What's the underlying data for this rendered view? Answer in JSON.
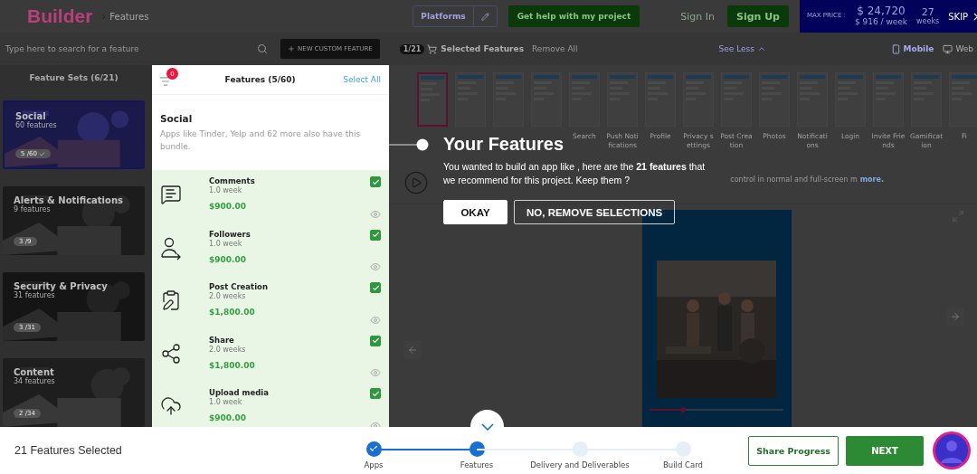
{
  "header": {
    "logo": "Builder",
    "breadcrumb": "Features",
    "platforms_button": "Platforms",
    "help_button": "Get help with my project",
    "sign_in": "Sign In",
    "sign_up": "Sign Up",
    "price": {
      "label": "MAX PRICE :",
      "total": "$ 24,720",
      "weekly": "$ 916 / week",
      "duration": "27",
      "duration_unit": "weeks"
    },
    "skip": "SKIP"
  },
  "toolbar": {
    "search_placeholder": "Type here to search for a feature",
    "new_feature_button": "NEW CUSTOM FEATURE",
    "selected_count": "1/21",
    "selected_label": "Selected Features",
    "remove_all": "Remove All",
    "see_less": "See Less",
    "views": [
      {
        "label": "Mobile",
        "selected": true
      },
      {
        "label": "Web",
        "selected": false
      }
    ]
  },
  "feature_sets": {
    "title": "Feature Sets (6/21)",
    "items": [
      {
        "name": "Social",
        "count": "60 features",
        "selected_count": "5 /60",
        "selected": true
      },
      {
        "name": "Alerts & Notifications",
        "count": "9 features",
        "selected_count": "3 /9",
        "selected": false
      },
      {
        "name": "Security & Privacy",
        "count": "31 features",
        "selected_count": "3 /31",
        "selected": false
      },
      {
        "name": "Content",
        "count": "34 features",
        "selected_count": "2 /34",
        "selected": false
      }
    ]
  },
  "features_panel": {
    "filter_badge": "0",
    "title": "Features (5/60)",
    "select_all": "Select All",
    "bundle": {
      "name": "Social",
      "description": "Apps like Tinder, Yelp and 62 more also have this bundle."
    },
    "items": [
      {
        "name": "Comments",
        "duration": "1.0 week",
        "price": "$900.00",
        "checked": true
      },
      {
        "name": "Followers",
        "duration": "1.0 week",
        "price": "$900.00",
        "checked": true
      },
      {
        "name": "Post Creation",
        "duration": "2.0 weeks",
        "price": "$1,800.00",
        "checked": true
      },
      {
        "name": "Share",
        "duration": "2.0 weeks",
        "price": "$1,800.00",
        "checked": true
      },
      {
        "name": "Upload media",
        "duration": "1.0 week",
        "price": "$900.00",
        "checked": true
      }
    ]
  },
  "preview": {
    "screens": [
      {
        "selected": true
      },
      {
        "selected": false
      },
      {
        "selected": false
      },
      {
        "selected": false
      },
      {
        "label": "Search",
        "selected": false
      },
      {
        "label": "Push Notifications",
        "selected": false
      },
      {
        "label": "Profile",
        "selected": false
      },
      {
        "label": "Privacy settings",
        "selected": false
      },
      {
        "label": "Post Creation",
        "selected": false
      },
      {
        "label": "Photos",
        "selected": false
      },
      {
        "label": "Notifications",
        "selected": false
      },
      {
        "label": "Login",
        "selected": false
      },
      {
        "label": "Invite Friends",
        "selected": false
      },
      {
        "label": "Gamification",
        "selected": false
      },
      {
        "label": "Fi",
        "selected": false
      }
    ],
    "description_tail": "control in normal and full-screen m",
    "more_link": "more.",
    "video_progress": {
      "level": 0.25
    }
  },
  "tour": {
    "title": "Your Features",
    "text": "You wanted to build an app like , here are the **21 features** that we recommend for this project. Keep them ?",
    "buttons": [
      {
        "label": "OKAY",
        "kind": "primary"
      },
      {
        "label": "NO, REMOVE SELECTIONS",
        "kind": "outline"
      }
    ]
  },
  "bottom_bar": {
    "summary": "21 Features Selected",
    "steps": [
      {
        "label": "Apps",
        "completed": true,
        "selected": false
      },
      {
        "label": "Features",
        "completed": false,
        "selected": true
      },
      {
        "label": "Delivery and Deliverables",
        "completed": false,
        "selected": false
      },
      {
        "label": "Build Card",
        "completed": false,
        "selected": false
      }
    ],
    "share_button": "Share Progress",
    "next_button": "NEXT"
  }
}
